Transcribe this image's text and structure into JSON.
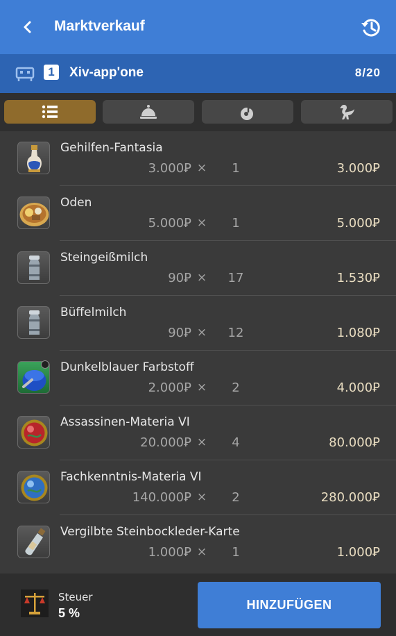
{
  "header": {
    "title": "Marktverkauf",
    "back_icon": "chevron-left-icon",
    "history_icon": "history-icon"
  },
  "retainer": {
    "icon": "retainer-bell-icon",
    "number": "1",
    "name": "Xiv-app'one",
    "count": "8/20"
  },
  "tabs": [
    {
      "icon": "list-icon",
      "active": true
    },
    {
      "icon": "service-bell-icon",
      "active": false
    },
    {
      "icon": "music-note-icon",
      "active": false
    },
    {
      "icon": "chocobo-icon",
      "active": false
    }
  ],
  "items": [
    {
      "name": "Gehilfen-Fantasia",
      "price": "3.000Ꝑ",
      "times": "×",
      "qty": "1",
      "total": "3.000Ꝑ",
      "icon": "fantasia-bottle-icon"
    },
    {
      "name": "Oden",
      "price": "5.000Ꝑ",
      "times": "×",
      "qty": "1",
      "total": "5.000Ꝑ",
      "icon": "oden-dish-icon"
    },
    {
      "name": "Steingeißmilch",
      "price": "90Ꝑ",
      "times": "×",
      "qty": "17",
      "total": "1.530Ꝑ",
      "icon": "milk-can-icon"
    },
    {
      "name": "Büffelmilch",
      "price": "90Ꝑ",
      "times": "×",
      "qty": "12",
      "total": "1.080Ꝑ",
      "icon": "milk-can-icon"
    },
    {
      "name": "Dunkelblauer Farbstoff",
      "price": "2.000Ꝑ",
      "times": "×",
      "qty": "2",
      "total": "4.000Ꝑ",
      "icon": "dye-pot-icon"
    },
    {
      "name": "Assassinen-Materia VI",
      "price": "20.000Ꝑ",
      "times": "×",
      "qty": "4",
      "total": "80.000Ꝑ",
      "icon": "red-materia-icon"
    },
    {
      "name": "Fachkenntnis-Materia VI",
      "price": "140.000Ꝑ",
      "times": "×",
      "qty": "2",
      "total": "280.000Ꝑ",
      "icon": "blue-materia-icon"
    },
    {
      "name": "Vergilbte Steinbockleder-Karte",
      "price": "1.000Ꝑ",
      "times": "×",
      "qty": "1",
      "total": "1.000Ꝑ",
      "icon": "map-bottle-icon"
    }
  ],
  "footer": {
    "tax_label": "Steuer",
    "tax_value": "5 %",
    "tax_icon": "scales-icon",
    "add_label": "HINZUFÜGEN"
  },
  "colors": {
    "header_blue": "#3f7ed6",
    "retainer_blue": "#2d64b3",
    "active_tab": "#8f6b2c",
    "background": "#3a3a3a"
  }
}
